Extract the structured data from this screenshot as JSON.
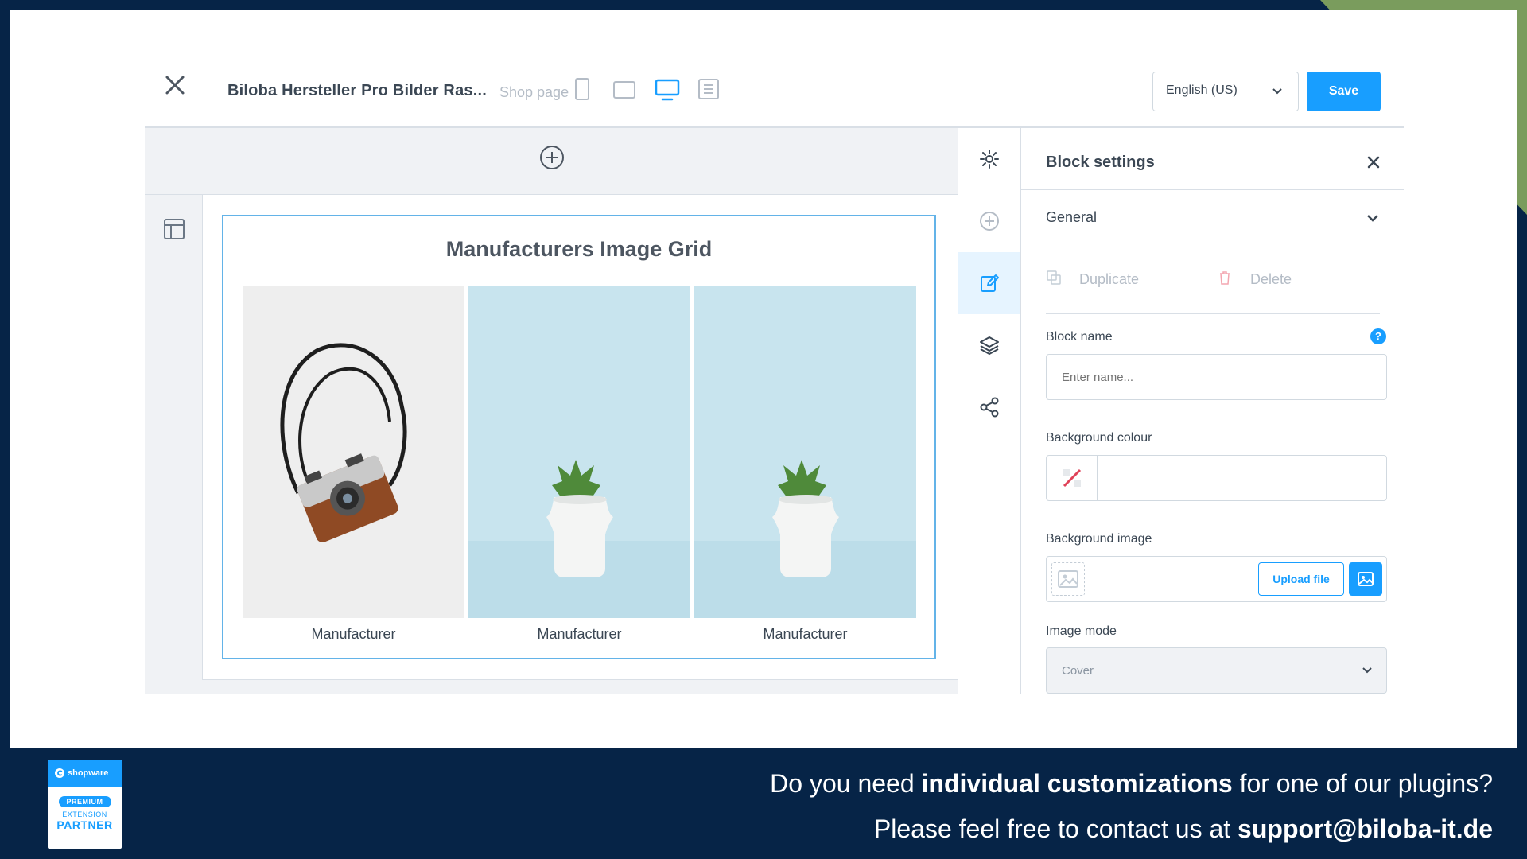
{
  "topbar": {
    "page_title": "Biloba Hersteller Pro Bilder Ras...",
    "shop_page_label": "Shop page",
    "language": "English (US)",
    "save_label": "Save"
  },
  "block": {
    "title": "Manufacturers Image Grid",
    "items": [
      {
        "caption": "Manufacturer",
        "image": "camera"
      },
      {
        "caption": "Manufacturer",
        "image": "plant"
      },
      {
        "caption": "Manufacturer",
        "image": "plant"
      }
    ]
  },
  "settings": {
    "title": "Block settings",
    "general_label": "General",
    "duplicate_label": "Duplicate",
    "delete_label": "Delete",
    "block_name_label": "Block name",
    "block_name_placeholder": "Enter name...",
    "help_glyph": "?",
    "bg_colour_label": "Background colour",
    "bg_image_label": "Background image",
    "upload_label": "Upload file",
    "image_mode_label": "Image mode",
    "image_mode_value": "Cover"
  },
  "footer": {
    "line1_a": "Do you need ",
    "line1_b": "individual customizations",
    "line1_c": " for one of our plugins?",
    "line2_a": "Please feel free to contact us at ",
    "line2_b": "support@biloba-it.de",
    "badge_brand": "shopware",
    "badge_tier": "PREMIUM",
    "badge_ext": "EXTENSION",
    "badge_partner": "PARTNER"
  },
  "colors": {
    "accent": "#189eff",
    "background": "#062447",
    "block_border": "#63b3e8",
    "corner_green": "#7a9c5d"
  },
  "icons": [
    "close-icon",
    "phone-icon",
    "tablet-icon",
    "desktop-icon",
    "list-icon",
    "chevron-down-icon",
    "plus-circle-icon",
    "layout-icon",
    "gear-icon",
    "edit-icon",
    "layers-icon",
    "share-icon",
    "copy-icon",
    "trash-icon",
    "no-color-icon",
    "image-icon"
  ]
}
